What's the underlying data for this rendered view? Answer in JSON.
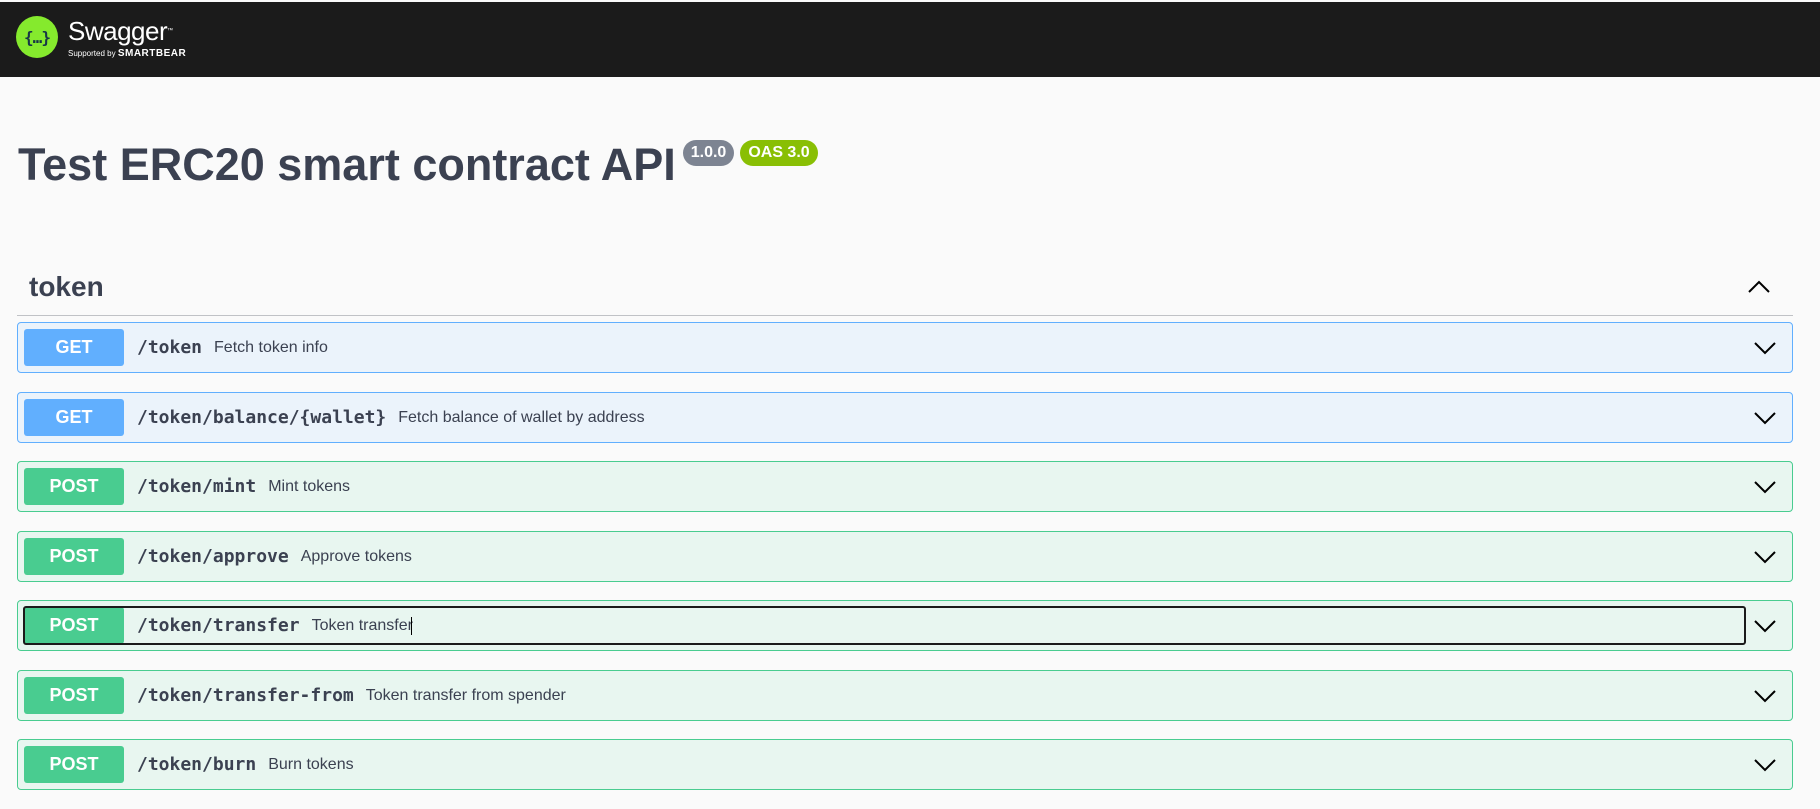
{
  "topbar": {
    "logo_glyph": "{…}",
    "logo_name": "Swagger",
    "logo_tm": "™",
    "logo_supported": "Supported by ",
    "logo_company": "SMARTBEAR"
  },
  "info": {
    "title": "Test ERC20 smart contract API",
    "version": "1.0.0",
    "oas": "OAS 3.0"
  },
  "tag": {
    "name": "token",
    "toggle_icon": "chevron-up-icon"
  },
  "colors": {
    "get": "#61affe",
    "post": "#49cc90",
    "topbar": "#1b1b1b",
    "logo": "#85ea2d"
  },
  "operations": [
    {
      "method": "GET",
      "path": "/token",
      "summary": "Fetch token info"
    },
    {
      "method": "GET",
      "path": "/token/balance/{wallet}",
      "summary": "Fetch balance of wallet by address"
    },
    {
      "method": "POST",
      "path": "/token/mint",
      "summary": "Mint tokens"
    },
    {
      "method": "POST",
      "path": "/token/approve",
      "summary": "Approve tokens"
    },
    {
      "method": "POST",
      "path": "/token/transfer",
      "summary": "Token transfer"
    },
    {
      "method": "POST",
      "path": "/token/transfer-from",
      "summary": "Token transfer from spender"
    },
    {
      "method": "POST",
      "path": "/token/burn",
      "summary": "Burn tokens"
    }
  ]
}
